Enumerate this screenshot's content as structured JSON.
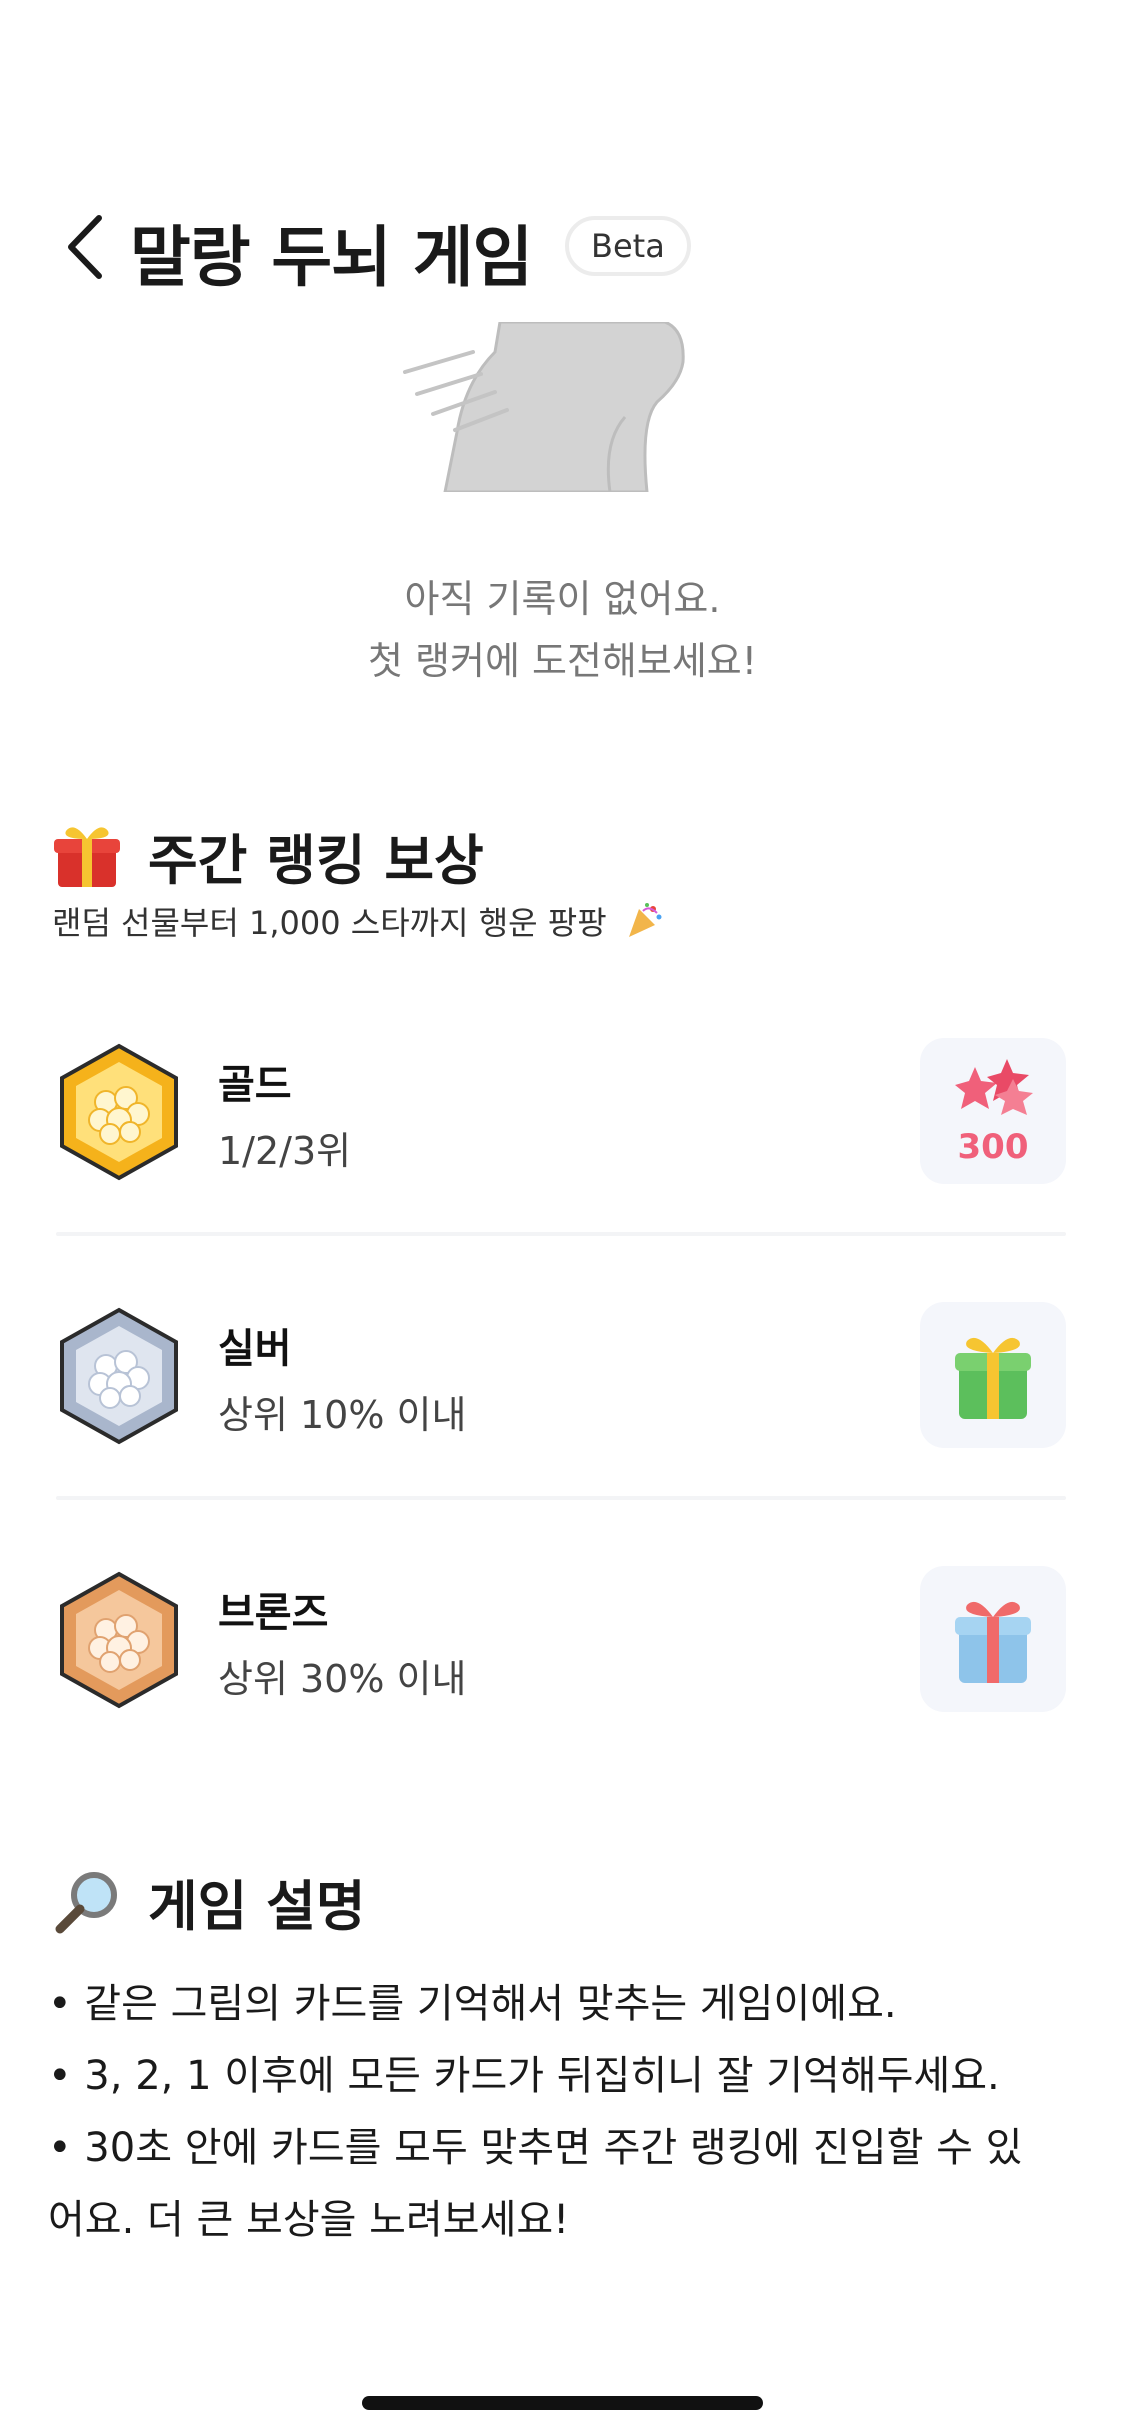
{
  "header": {
    "title": "말랑 두뇌 게임",
    "badge": "Beta"
  },
  "empty_state": {
    "line1": "아직 기록이 없어요.",
    "line2": "첫 랭커에 도전해보세요!"
  },
  "rewards_section": {
    "title": "주간 랭킹 보상",
    "subtitle": "랜덤 선물부터 1,000 스타까지 행운 팡팡",
    "tiers": [
      {
        "name": "골드",
        "desc": "1/2/3위",
        "reward_label": "300",
        "badge_color": "#f5b21b",
        "reward_icon": "star-bundle-icon"
      },
      {
        "name": "실버",
        "desc": "상위 10% 이내",
        "reward_label": "",
        "badge_color": "#a9b6cc",
        "reward_icon": "green-gift-icon"
      },
      {
        "name": "브론즈",
        "desc": "상위 30% 이내",
        "reward_label": "",
        "badge_color": "#e39a5c",
        "reward_icon": "blue-gift-icon"
      }
    ]
  },
  "game_description": {
    "title": "게임 설명",
    "items": [
      "• 같은 그림의 카드를 기억해서 맞추는 게임이에요.",
      "• 3, 2, 1 이후에 모든 카드가 뒤집히니 잘 기억해두세요.",
      "• 30초 안에 카드를 모두 맞추면 주간 랭킹에 진입할 수 있",
      "어요. 더 큰 보상을 노려보세요!"
    ]
  },
  "colors": {
    "accent_pink": "#f0607a",
    "text_primary": "#1a1a1a",
    "text_secondary": "#777777",
    "reward_bg": "#f4f6fb"
  }
}
